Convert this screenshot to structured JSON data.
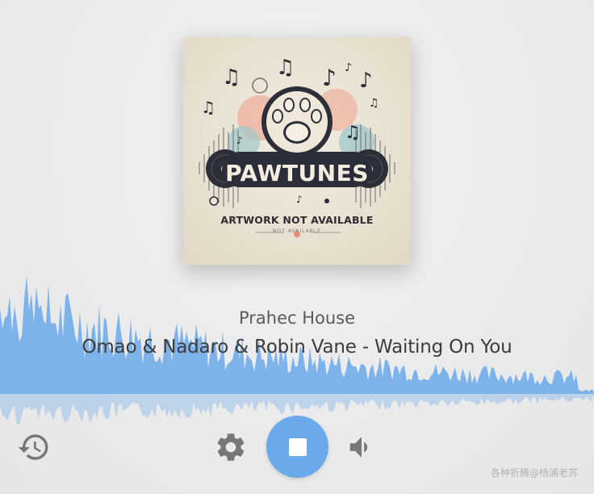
{
  "artwork": {
    "logo_text": "PAWTUNES",
    "caption": "ARTWORK NOT AVAILABLE",
    "subcaption": "NOT AVAILABLE"
  },
  "player": {
    "station": "Prahec House",
    "track": "Omao & Nadaro & Robin Vane - Waiting On You"
  },
  "controls": {
    "history_icon": "history-icon",
    "settings_icon": "gear-icon",
    "stop_icon": "stop-icon",
    "volume_icon": "volume-icon"
  },
  "watermark": "各种折腾@杨浦老苏",
  "colors": {
    "accent": "#6aa9ea",
    "icon": "#777777"
  }
}
